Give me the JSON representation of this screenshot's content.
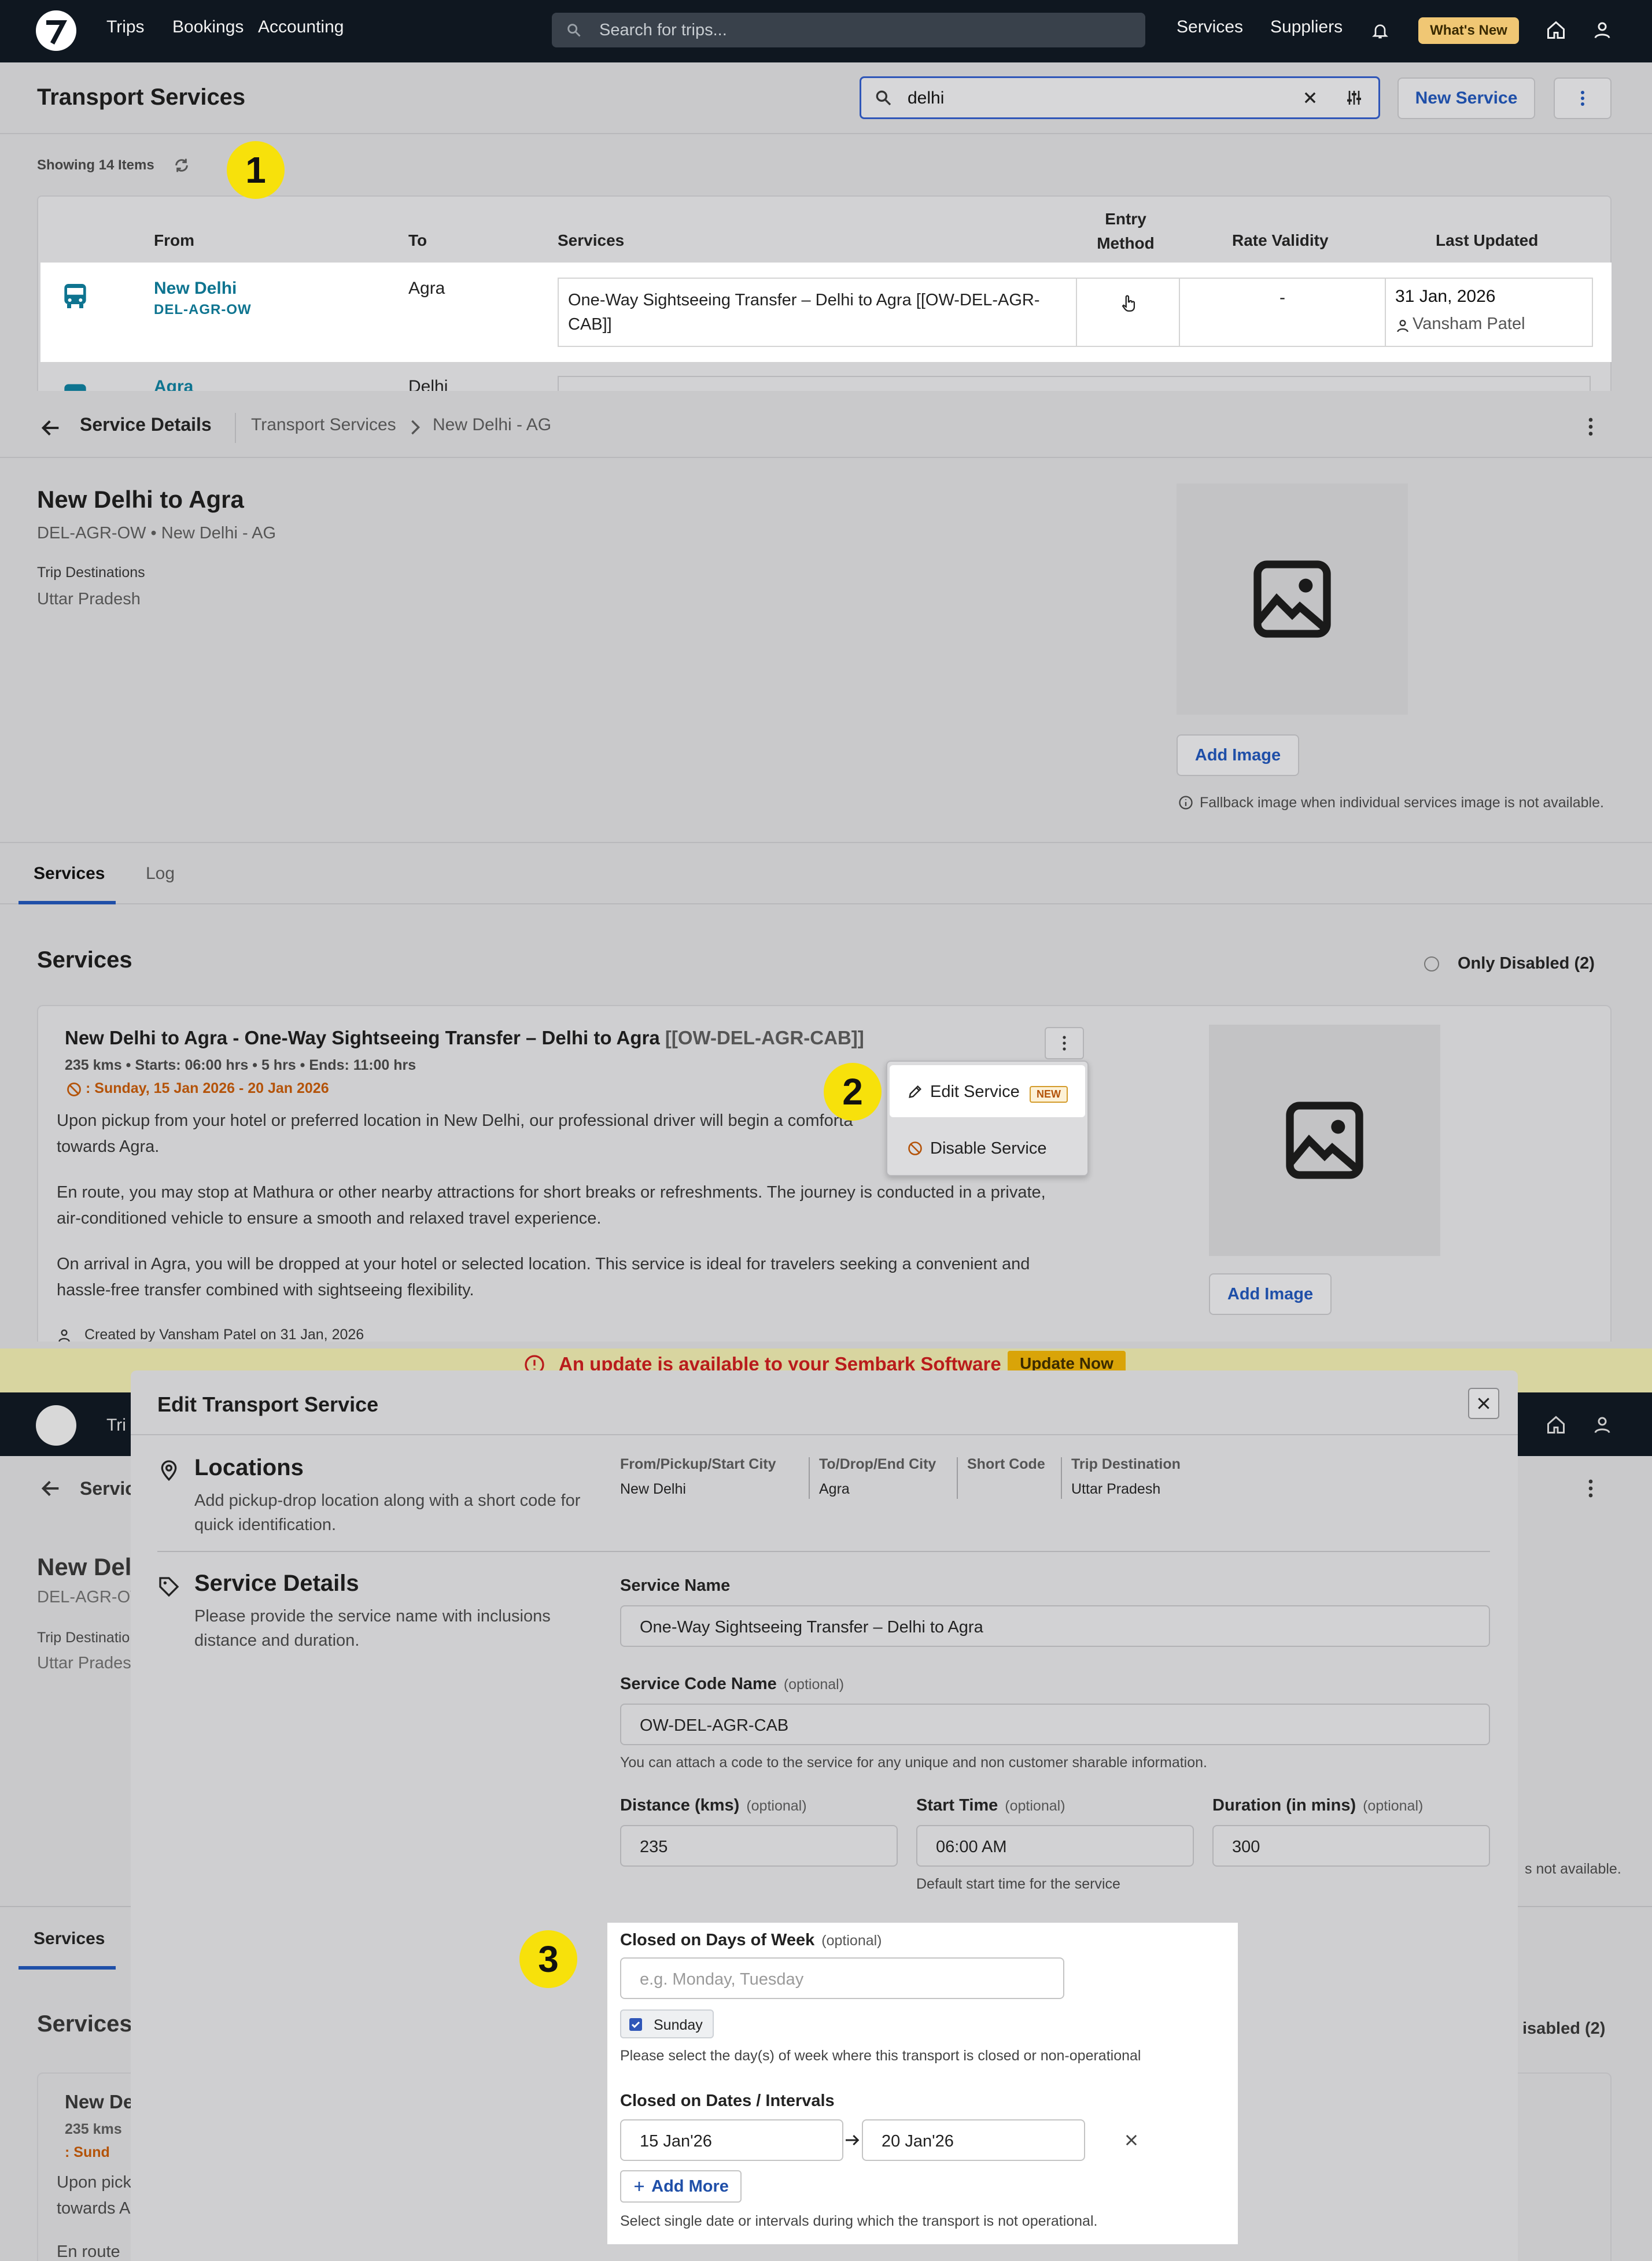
{
  "badges": [
    "1",
    "2",
    "3"
  ],
  "nav": {
    "links": [
      "Trips",
      "Bookings",
      "Accounting"
    ],
    "search_placeholder": "Search for trips...",
    "right_links": [
      "Services",
      "Suppliers"
    ],
    "whats_new": "What's New"
  },
  "p1": {
    "title": "Transport Services",
    "search_value": "delhi",
    "new_service": "New Service",
    "showing": "Showing 14 Items",
    "columns": {
      "from": "From",
      "to": "To",
      "services": "Services",
      "entry_method": "Entry Method",
      "rate_validity": "Rate Validity",
      "last_updated": "Last Updated"
    },
    "rows": [
      {
        "from": "New Delhi",
        "code": "DEL-AGR-OW",
        "to": "Agra",
        "service": "One-Way Sightseeing Transfer – Delhi to Agra [[OW-DEL-AGR-CAB]]",
        "rate_validity": "-",
        "date": "31 Jan, 2026",
        "user": "Vansham Patel"
      },
      {
        "from": "Agra",
        "to": "Delhi"
      }
    ]
  },
  "p2": {
    "header": "Service Details",
    "breadcrumb": [
      "Transport Services",
      "New Delhi - AG"
    ],
    "title": "New Delhi to Agra",
    "subtitle_code": "DEL-AGR-OW",
    "subtitle_name": "New Delhi - AG",
    "dest_label": "Trip Destinations",
    "dest_value": "Uttar Pradesh",
    "add_image": "Add Image",
    "fallback_note": "Fallback image when individual services image is not available.",
    "tabs": [
      "Services",
      "Log"
    ],
    "services_heading": "Services",
    "only_disabled": "Only Disabled (2)",
    "card": {
      "title": "New Delhi to Agra - One-Way Sightseeing Transfer – Delhi to Agra",
      "code": "[[OW-DEL-AGR-CAB]]",
      "meta": [
        "235 kms",
        "Starts: 06:00 hrs",
        "5 hrs",
        "Ends: 11:00 hrs"
      ],
      "closed": ": Sunday, 15 Jan 2026 - 20 Jan 2026",
      "paragraphs": [
        "Upon pickup from your hotel or preferred location in New Delhi, our professional driver will begin a comforta",
        "towards Agra.",
        "En route, you may stop at Mathura or other nearby attractions for short breaks or refreshments. The journey is conducted in a private,",
        "air-conditioned vehicle to ensure a smooth and relaxed travel experience.",
        "On arrival in Agra, you will be dropped at your hotel or selected location. This service is ideal for travelers seeking a convenient and",
        "hassle-free transfer combined with sightseeing flexibility."
      ],
      "created": "Created by Vansham Patel on 31 Jan, 2026"
    },
    "menu": {
      "edit": "Edit Service",
      "new_tag": "NEW",
      "disable": "Disable Service"
    }
  },
  "p3": {
    "banner": "An update is available to your Sembark Software",
    "banner_btn": "Update Now",
    "modal_title": "Edit Transport Service",
    "locations": {
      "title": "Locations",
      "desc1": "Add pickup-drop location along with a short code for",
      "desc2": "quick identification.",
      "cols": [
        {
          "label": "From/Pickup/Start City",
          "value": "New Delhi"
        },
        {
          "label": "To/Drop/End City",
          "value": "Agra"
        },
        {
          "label": "Short Code",
          "value": ""
        },
        {
          "label": "Trip Destination",
          "value": "Uttar Pradesh"
        }
      ]
    },
    "details": {
      "title": "Service Details",
      "desc1": "Please provide the service name with inclusions",
      "desc2": "distance and duration."
    },
    "service_name_label": "Service Name",
    "service_name": "One-Way Sightseeing Transfer – Delhi to Agra",
    "code_label": "Service Code Name",
    "optional": "(optional)",
    "code_value": "OW-DEL-AGR-CAB",
    "code_hint": "You can attach a code to the service for any unique and non customer sharable information.",
    "distance_label": "Distance (kms)",
    "distance": "235",
    "start_label": "Start Time",
    "start": "06:00 AM",
    "start_hint": "Default start time for the service",
    "duration_label": "Duration (in mins)",
    "duration": "300",
    "closed_days_label": "Closed on Days of Week",
    "closed_days_ph": "e.g. Monday, Tuesday",
    "chip": "Sunday",
    "closed_days_hint": "Please select the day(s) of week where this transport is closed or non-operational",
    "closed_dates_label": "Closed on Dates / Intervals",
    "date_from": "15 Jan'26",
    "date_to": "20 Jan'26",
    "add_more": "Add More",
    "dates_hint": "Select single date or intervals during which the transport is not operational.",
    "bg": {
      "nav": "Tri",
      "services_tab": "Services",
      "services_heading": "Services",
      "disabled_frag": "isabled (2)",
      "fallback_frag": "s not available.",
      "title_frag": "New Del",
      "code_frag": "DEL-AGR-OV",
      "dest_frag": "Trip Destinatio",
      "dest_val_frag": "Uttar Prades",
      "card_title_frag": "New De",
      "card_meta_frag": "235 kms",
      "card_closed_frag": ": Sund",
      "card_p1": "Upon pick",
      "card_p2": "towards A",
      "card_p3": "En route",
      "header_frag": "Servic"
    }
  },
  "colors": {
    "nav": "#0f1720",
    "accent": "#1f4fa8",
    "link": "#0e7490",
    "badge": "#f7e10b",
    "warn": "#b45309"
  }
}
